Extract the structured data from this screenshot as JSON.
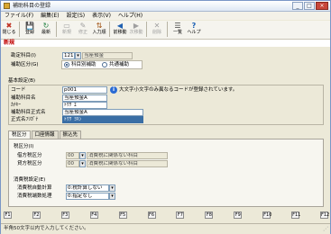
{
  "window": {
    "title": "補助科目の登録",
    "controls": [
      "_",
      "□",
      "×"
    ]
  },
  "menu": [
    "ファイル(F)",
    "編集(E)",
    "設定(S)",
    "表示(V)",
    "ヘルプ(H)"
  ],
  "toolbar": [
    {
      "label": "閉じる",
      "icon": "close-icon",
      "glyph": "✖",
      "enabled": true
    },
    {
      "label": "登録",
      "icon": "save-icon",
      "glyph": "💾",
      "enabled": true
    },
    {
      "label": "最新",
      "icon": "refresh-icon",
      "glyph": "↻",
      "enabled": true
    },
    {
      "label": "新規",
      "icon": "new-icon",
      "glyph": "▭",
      "enabled": false
    },
    {
      "label": "修正",
      "icon": "edit-icon",
      "glyph": "✎",
      "enabled": false
    },
    {
      "label": "入力順",
      "icon": "order-icon",
      "glyph": "⇅",
      "enabled": true
    },
    {
      "label": "前移動",
      "icon": "move-prev-icon",
      "glyph": "◀",
      "enabled": true
    },
    {
      "label": "次移動",
      "icon": "move-next-icon",
      "glyph": "▶",
      "enabled": false
    },
    {
      "label": "削除",
      "icon": "delete-icon",
      "glyph": "✕",
      "enabled": false
    },
    {
      "label": "一覧",
      "icon": "list-icon",
      "glyph": "☰",
      "enabled": true
    },
    {
      "label": "ヘルプ",
      "icon": "help-icon",
      "glyph": "?",
      "enabled": true
    }
  ],
  "mode_label": "新規",
  "header": {
    "account_label": "勘定科目(I)",
    "account_code": "121",
    "account_name": "当座預金",
    "subtype_label": "補助区分(G)",
    "subtype_options": [
      "科目別補助",
      "共通補助"
    ],
    "subtype_selected": 0
  },
  "basic": {
    "section_label": "基本設定(B)",
    "code_label": "コード",
    "code_value": "p001",
    "code_note": "大文字小文字のみ異なるコードが登録されています。",
    "name_label": "補助科目名",
    "name_value": "当座預金A",
    "kana_label": "ｶﾅｷｰ",
    "kana_value": "ﾄｳｻﾞｴ",
    "formal_label": "補助科目正式名",
    "formal_value": "当座預金A",
    "formal_kana_label": "正式名ﾌﾘｶﾞﾅ",
    "formal_kana_value": "ﾄｳｻﾞﾖｷﾝ"
  },
  "tabs": [
    "税区分",
    "口座情報",
    "振込先"
  ],
  "tax": {
    "section_label": "税区分(I)",
    "debit_label": "借方税区分",
    "debit_code": "00",
    "debit_value": "消費税に関係ない科目",
    "credit_label": "貸方税区分",
    "credit_code": "00",
    "credit_value": "消費税に関係ない科目",
    "calc_section_label": "消費税設定(E)",
    "calc_label": "消費税自動計算",
    "calc_value": "0:税計算しない",
    "rounding_label": "消費税端数処理",
    "rounding_value": "0:指定なし"
  },
  "fkeys": [
    "F1",
    "F2",
    "F3",
    "F4",
    "F5",
    "F6",
    "F7",
    "F8",
    "F9",
    "F10",
    "F11",
    "F12"
  ],
  "status_text": "半角50文字以内で入力してください。"
}
